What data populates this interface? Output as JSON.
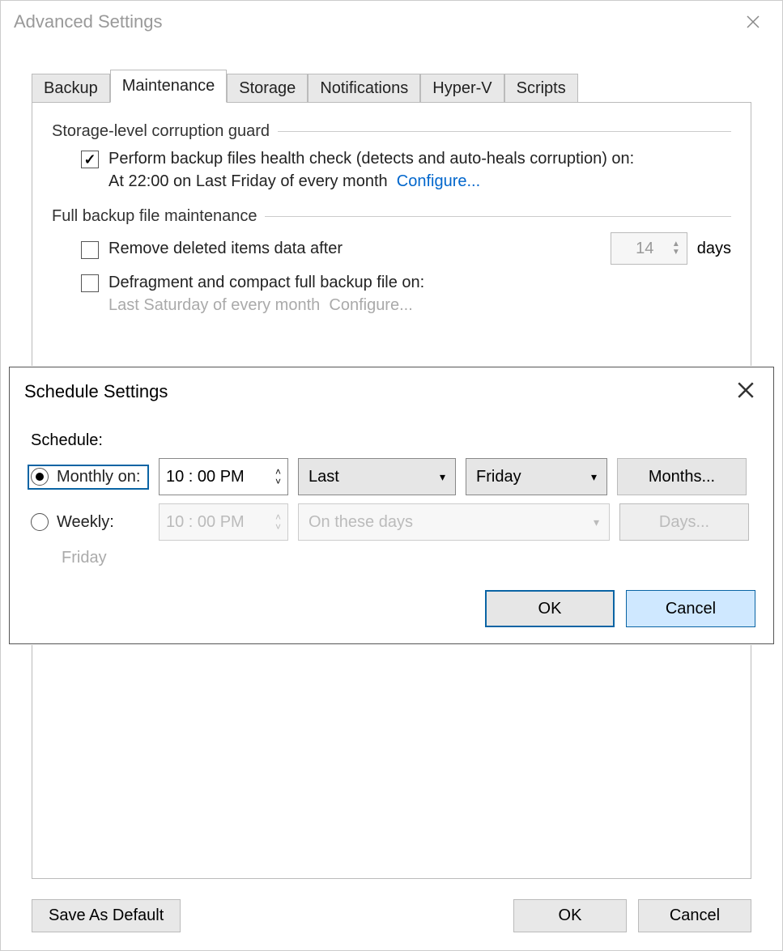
{
  "window": {
    "title": "Advanced Settings"
  },
  "tabs": {
    "items": [
      "Backup",
      "Maintenance",
      "Storage",
      "Notifications",
      "Hyper-V",
      "Scripts"
    ],
    "active_index": 1
  },
  "maintenance": {
    "group1_title": "Storage-level corruption guard",
    "healthcheck_checked": true,
    "healthcheck_label": "Perform backup files health check (detects and auto-heals corruption) on:",
    "healthcheck_schedule": "At 22:00 on Last Friday of every month",
    "configure_link": "Configure...",
    "group2_title": "Full backup file maintenance",
    "remove_checked": false,
    "remove_label": "Remove deleted items data after",
    "remove_days_value": "14",
    "remove_days_unit": "days",
    "defrag_checked": false,
    "defrag_label": "Defragment and compact full backup file on:",
    "defrag_schedule": "Last Saturday of every month",
    "defrag_configure": "Configure..."
  },
  "schedule_modal": {
    "title": "Schedule Settings",
    "schedule_label": "Schedule:",
    "monthly_label": "Monthly on:",
    "monthly_selected": true,
    "monthly_time": "10 : 00 PM",
    "monthly_ordinal": "Last",
    "monthly_day": "Friday",
    "months_button": "Months...",
    "weekly_label": "Weekly:",
    "weekly_selected": false,
    "weekly_time": "10 : 00 PM",
    "weekly_days_placeholder": "On these days",
    "days_button": "Days...",
    "friday_note": "Friday",
    "ok_label": "OK",
    "cancel_label": "Cancel"
  },
  "footer": {
    "save_default": "Save As Default",
    "ok": "OK",
    "cancel": "Cancel"
  }
}
